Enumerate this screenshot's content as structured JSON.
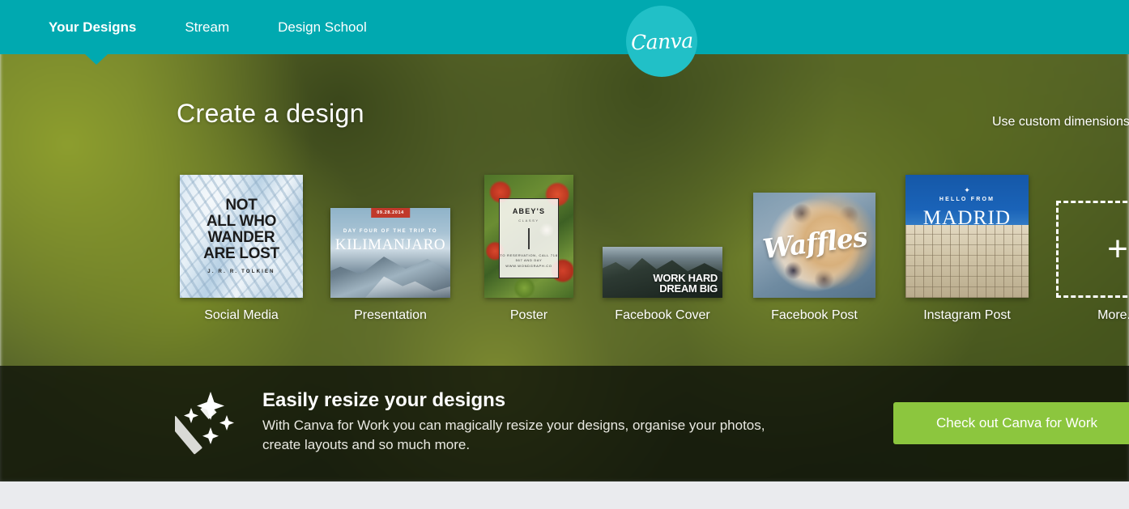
{
  "header": {
    "nav": [
      {
        "label": "Your Designs",
        "active": true
      },
      {
        "label": "Stream",
        "active": false
      },
      {
        "label": "Design School",
        "active": false
      }
    ],
    "logo_text": "Canva",
    "teal": "#00a9b0",
    "logo_circle": "#21c0c7"
  },
  "hero": {
    "title": "Create a design",
    "custom_dimensions": "Use custom dimensions"
  },
  "tiles": [
    {
      "label": "Social Media",
      "art": {
        "line1": "NOT",
        "line2": "ALL WHO",
        "line3": "WANDER",
        "line4": "ARE LOST",
        "author": "J. R. R. TOLKIEN"
      }
    },
    {
      "label": "Presentation",
      "art": {
        "date": "09.28.2014",
        "subtitle": "DAY FOUR OF THE TRIP TO",
        "title": "KILIMANJARO"
      }
    },
    {
      "label": "Poster",
      "art": {
        "name": "ABEY'S",
        "sub": "CLASSY",
        "info": "TO RESERVATION, CALL 718 567 AND DAY WWW.WONDGRAPH.CO"
      }
    },
    {
      "label": "Facebook Cover",
      "art": {
        "line1": "WORK HARD",
        "line2": "DREAM BIG"
      }
    },
    {
      "label": "Facebook Post",
      "art": {
        "title": "Waffles"
      }
    },
    {
      "label": "Instagram Post",
      "art": {
        "star": "✦",
        "hello": "HELLO FROM",
        "city": "MADRID"
      }
    },
    {
      "label": "More...",
      "art": {
        "plus": "+"
      }
    }
  ],
  "promo": {
    "title": "Easily resize your designs",
    "body": "With Canva for Work you can magically resize your designs, organise your photos, create layouts and so much more.",
    "cta_label": "Check out Canva for Work",
    "cta_color": "#8cc63e",
    "icon": "magic-wand-icon"
  }
}
